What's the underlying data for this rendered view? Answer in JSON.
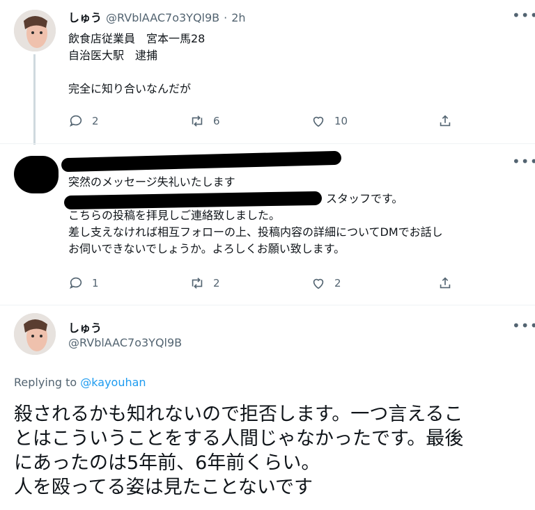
{
  "tweet1": {
    "name": "しゅう",
    "handle": "@RVblAAC7o3YQl9B",
    "sep": "·",
    "time": "2h",
    "text": "飲食店従業員　宮本一馬28\n自治医大駅　逮捕\n\n完全に知り合いなんだが",
    "replies": "2",
    "retweets": "6",
    "likes": "10"
  },
  "tweet2": {
    "text_line1": "突然のメッセージ失礼いたします",
    "text_line2_visible": "スタッフです。",
    "text_rest": "こちらの投稿を拝見しご連絡致しました。\n差し支えなければ相互フォローの上、投稿内容の詳細についてDMでお話し\nお伺いできないでしょうか。よろしくお願い致します。",
    "replies": "1",
    "retweets": "2",
    "likes": "2"
  },
  "tweet3": {
    "name": "しゅう",
    "handle": "@RVblAAC7o3YQl9B",
    "replying_prefix": "Replying to",
    "replying_to": "@kayouhan",
    "text": "殺されるかも知れないので拒否します。一つ言えるこ\nとはこういうことをする人間じゃなかったです。最後\nにあったのは5年前、6年前くらい。\n人を殴ってる姿は見たことないです"
  },
  "icons": {
    "more": "more-dots-icon",
    "reply": "reply-bubble-icon",
    "retweet": "retweet-icon",
    "like": "heart-icon",
    "share": "share-icon"
  }
}
